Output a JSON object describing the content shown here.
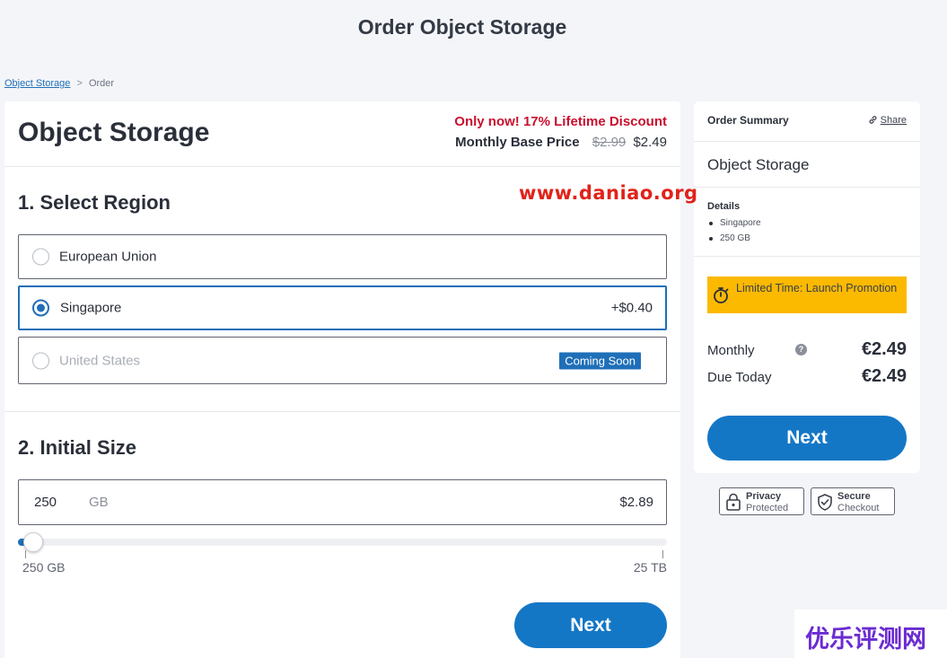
{
  "page": {
    "title": "Order Object Storage"
  },
  "breadcrumb": {
    "link": "Object Storage",
    "separator": ">",
    "current": "Order"
  },
  "product": {
    "title": "Object Storage",
    "discount": "Only now! 17% Lifetime Discount",
    "base_price_label": "Monthly Base Price",
    "old_price": "$2.99",
    "new_price": "$2.49"
  },
  "region": {
    "title": "1. Select Region",
    "options": [
      {
        "name": "European Union",
        "extra": "",
        "selected": false,
        "disabled": false
      },
      {
        "name": "Singapore",
        "extra": "+$0.40",
        "selected": true,
        "disabled": false
      },
      {
        "name": "United States",
        "badge": "Coming Soon",
        "selected": false,
        "disabled": true
      }
    ]
  },
  "size": {
    "title": "2. Initial Size",
    "value": "250",
    "unit": "GB",
    "price": "$2.89",
    "slider_min_label": "250 GB",
    "slider_max_label": "25 TB",
    "slider_fraction": 0.0
  },
  "main_next_label": "Next",
  "summary": {
    "title": "Order Summary",
    "share_label": "Share",
    "product": "Object Storage",
    "details_label": "Details",
    "details": [
      "Singapore",
      "250 GB"
    ],
    "promo": "Limited Time: Launch Promotion",
    "monthly_label": "Monthly",
    "monthly_value": "€2.49",
    "due_label": "Due Today",
    "due_value": "€2.49",
    "next_label": "Next",
    "help_symbol": "?"
  },
  "trust": {
    "privacy_title": "Privacy",
    "privacy_sub": "Protected",
    "secure_title": "Secure",
    "secure_sub": "Checkout"
  },
  "watermark": "www.daniao.org",
  "corner_logo": "优乐评测网",
  "colors": {
    "accent": "#1477c6",
    "discount": "#c8102e",
    "promo": "#fbb900"
  }
}
